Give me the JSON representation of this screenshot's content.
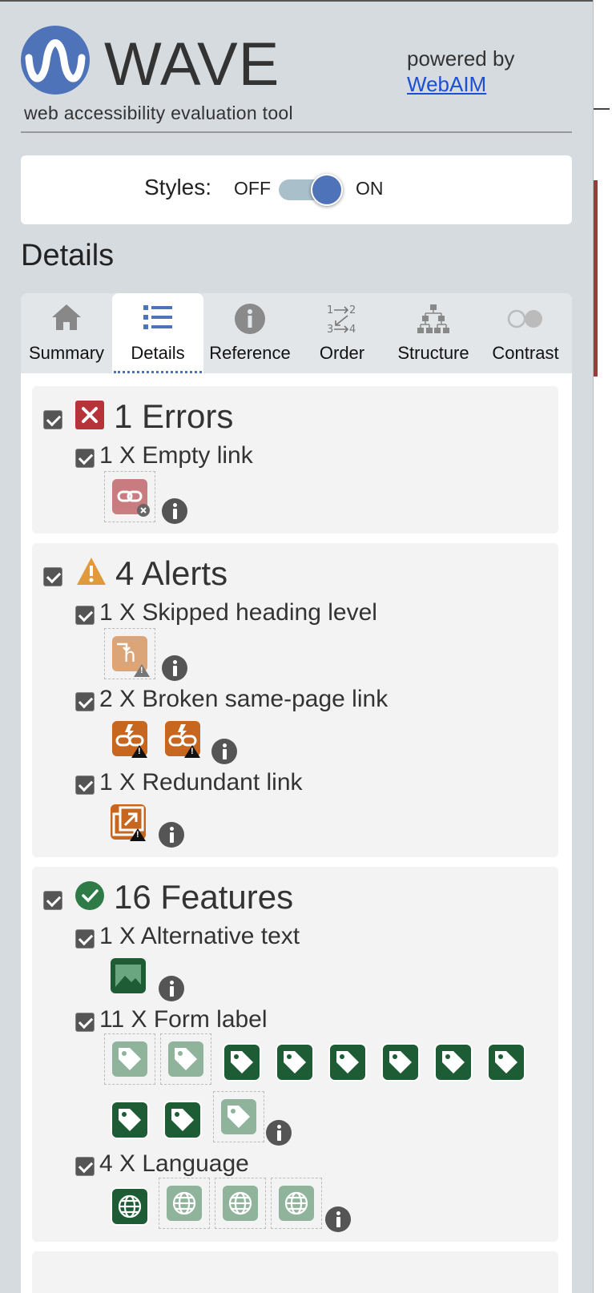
{
  "header": {
    "logo_title": "WAVE",
    "powered_by": "powered by",
    "webaim_link": "WebAIM",
    "tagline": "web accessibility evaluation tool"
  },
  "styles_toggle": {
    "label": "Styles:",
    "off": "OFF",
    "on": "ON",
    "state": "on"
  },
  "details_heading": "Details",
  "tabs": [
    {
      "label": "Summary",
      "icon": "home-icon"
    },
    {
      "label": "Details",
      "icon": "list-icon",
      "active": true
    },
    {
      "label": "Reference",
      "icon": "info-icon"
    },
    {
      "label": "Order",
      "icon": "order-icon"
    },
    {
      "label": "Structure",
      "icon": "structure-icon"
    },
    {
      "label": "Contrast",
      "icon": "contrast-icon"
    }
  ],
  "errors": {
    "title": "1 Errors",
    "items": [
      {
        "label": "1 X Empty link",
        "icon_count": 1
      }
    ]
  },
  "alerts": {
    "title": "4 Alerts",
    "items": [
      {
        "label": "1 X Skipped heading level",
        "icon_count": 1
      },
      {
        "label": "2 X Broken same-page link",
        "icon_count": 2
      },
      {
        "label": "1 X Redundant link",
        "icon_count": 1
      }
    ]
  },
  "features": {
    "title": "16 Features",
    "items": [
      {
        "label": "1 X Alternative text",
        "icon_count": 1
      },
      {
        "label": "11 X Form label",
        "icon_count": 11
      },
      {
        "label": "4 X Language",
        "icon_count": 4
      }
    ]
  },
  "colors": {
    "accent": "#4e73b8",
    "error": "#b7333a",
    "alert": "#c7671f",
    "feature": "#1d5c34"
  }
}
